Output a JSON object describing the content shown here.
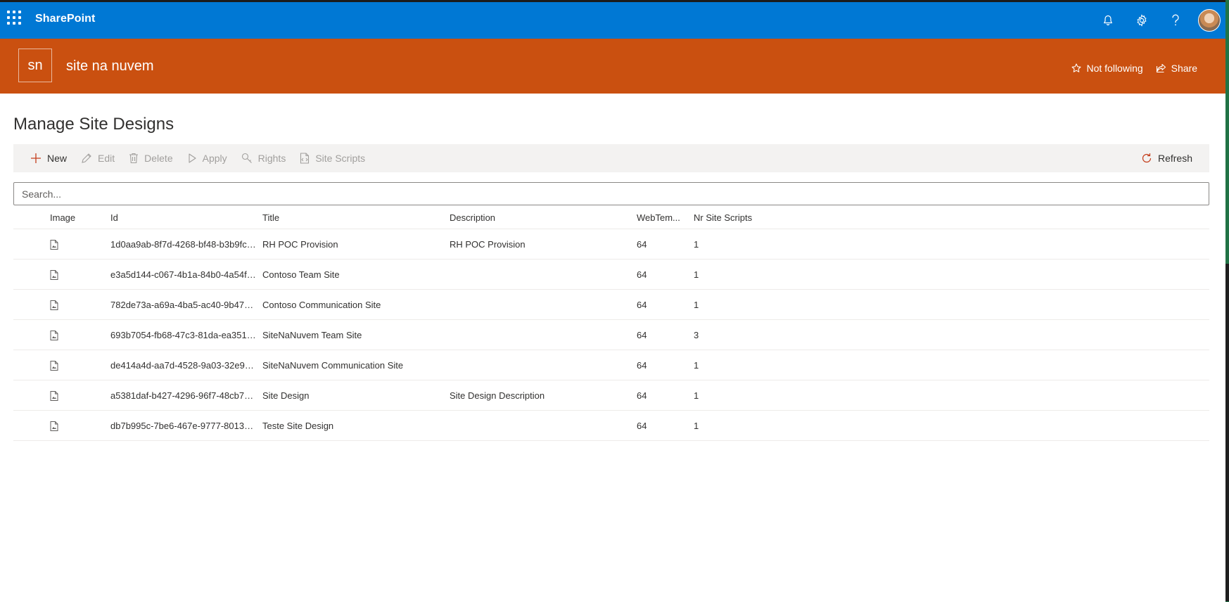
{
  "suite": {
    "app_name": "SharePoint",
    "icons": [
      "waffle-icon",
      "bell-icon",
      "gear-icon",
      "help-icon",
      "avatar"
    ]
  },
  "site": {
    "logo_text": "sn",
    "title": "site na nuvem",
    "follow_label": "Not following",
    "share_label": "Share",
    "header_color": "#ca5010",
    "suite_color": "#0078d4"
  },
  "page": {
    "title": "Manage Site Designs"
  },
  "commands": {
    "new": "New",
    "edit": "Edit",
    "delete": "Delete",
    "apply": "Apply",
    "rights": "Rights",
    "site_scripts": "Site Scripts",
    "refresh": "Refresh"
  },
  "search": {
    "placeholder": "Search...",
    "value": ""
  },
  "table": {
    "columns": [
      "Image",
      "Id",
      "Title",
      "Description",
      "WebTem...",
      "Nr Site Scripts"
    ],
    "rows": [
      {
        "id": "1d0aa9ab-8f7d-4268-bf48-b3b9fc0...",
        "title": "RH POC Provision",
        "description": "RH POC Provision",
        "webtemplate": "64",
        "nr_site_scripts": "1"
      },
      {
        "id": "e3a5d144-c067-4b1a-84b0-4a54fe...",
        "title": "Contoso Team Site",
        "description": "",
        "webtemplate": "64",
        "nr_site_scripts": "1"
      },
      {
        "id": "782de73a-a69a-4ba5-ac40-9b4706...",
        "title": "Contoso Communication Site",
        "description": "",
        "webtemplate": "64",
        "nr_site_scripts": "1"
      },
      {
        "id": "693b7054-fb68-47c3-81da-ea351d...",
        "title": "SiteNaNuvem Team Site",
        "description": "",
        "webtemplate": "64",
        "nr_site_scripts": "3"
      },
      {
        "id": "de414a4d-aa7d-4528-9a03-32e90...",
        "title": "SiteNaNuvem Communication Site",
        "description": "",
        "webtemplate": "64",
        "nr_site_scripts": "1"
      },
      {
        "id": "a5381daf-b427-4296-96f7-48cb70c...",
        "title": "Site Design",
        "description": "Site Design Description",
        "webtemplate": "64",
        "nr_site_scripts": "1"
      },
      {
        "id": "db7b995c-7be6-467e-9777-80138...",
        "title": "Teste Site Design",
        "description": "",
        "webtemplate": "64",
        "nr_site_scripts": "1"
      }
    ]
  }
}
